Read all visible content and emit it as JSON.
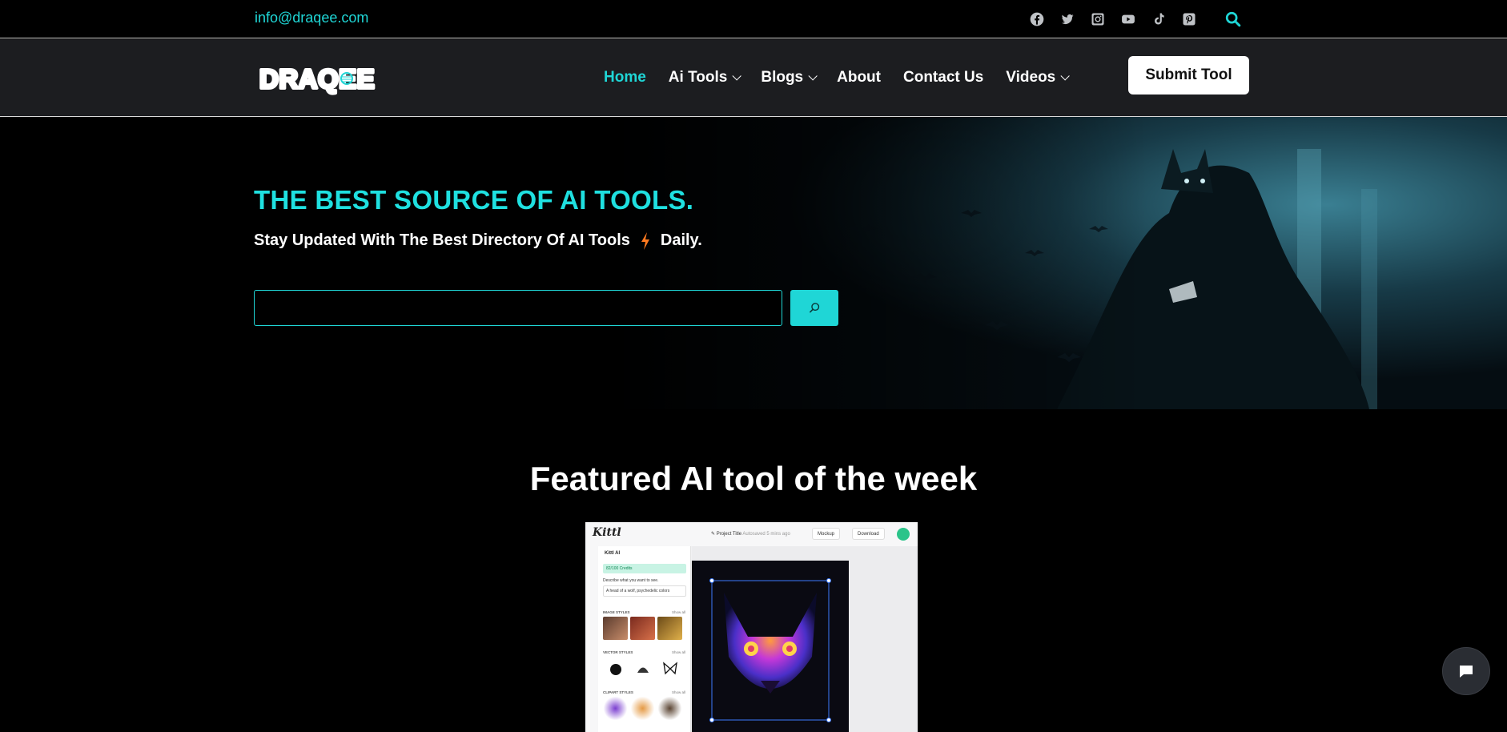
{
  "topbar": {
    "email": "info@draqee.com",
    "socials": [
      "facebook-icon",
      "twitter-icon",
      "instagram-icon",
      "youtube-icon",
      "tiktok-icon",
      "pinterest-icon"
    ],
    "search_icon": "search-icon"
  },
  "brand": {
    "logo_text": "DRAQEE"
  },
  "nav": {
    "items": [
      {
        "label": "Home",
        "active": true,
        "dropdown": false
      },
      {
        "label": "Ai Tools",
        "active": false,
        "dropdown": true
      },
      {
        "label": "Blogs",
        "active": false,
        "dropdown": true
      },
      {
        "label": "About",
        "active": false,
        "dropdown": false
      },
      {
        "label": "Contact Us",
        "active": false,
        "dropdown": false
      },
      {
        "label": "Videos",
        "active": false,
        "dropdown": true
      }
    ],
    "submit_label": "Submit Tool"
  },
  "hero": {
    "title": "THE BEST SOURCE OF AI TOOLS.",
    "subtitle_before": "Stay Updated With The Best Directory Of AI Tools",
    "subtitle_after": "Daily.",
    "search_placeholder": "",
    "search_value": ""
  },
  "featured": {
    "title": "Featured AI tool of the week",
    "screenshot": {
      "brand": "Kittl",
      "project_title": "Project Title",
      "autosaved": "Autosaved 5 mins ago",
      "mockup_label": "Mockup",
      "download_label": "Download",
      "panel_title": "Kittl AI",
      "credits": "82/100 Credits",
      "describe_label": "Describe what you want to see.",
      "prompt_text": "A head of a wolf, psychedelic colors",
      "sections": [
        "IMAGE STYLES",
        "VECTOR STYLES",
        "CLIPART STYLES"
      ],
      "show_all": "Show all"
    }
  },
  "colors": {
    "accent": "#1fd6d6",
    "nav_bg": "#1c1d20",
    "page_bg": "#000000"
  }
}
